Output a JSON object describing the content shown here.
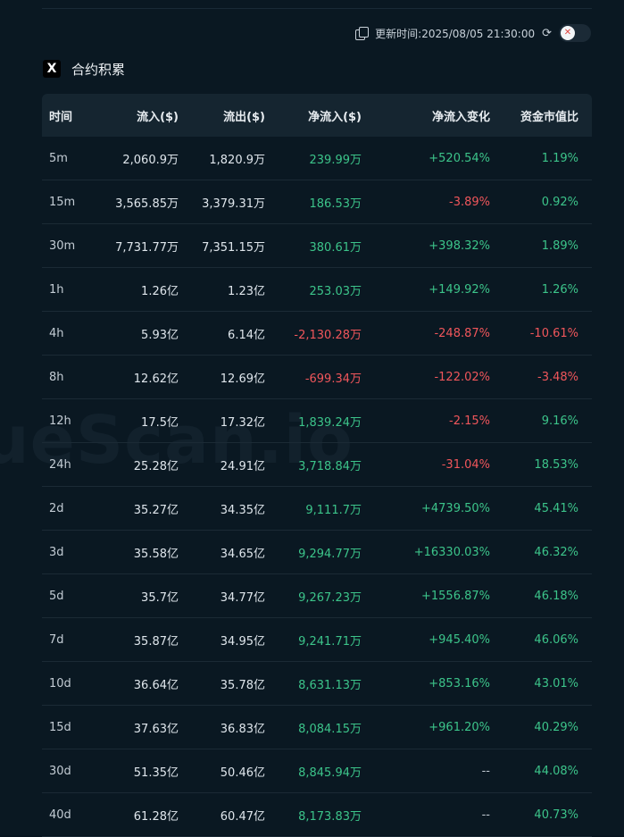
{
  "header": {
    "update_label": "更新时间:2025/08/05 21:30:00",
    "copy_icon": "copy-icon",
    "refresh_icon": "refresh-icon"
  },
  "title": {
    "icon_text": "X",
    "text": "合约积累"
  },
  "watermark": "ueScan.io",
  "table": {
    "columns": [
      "时间",
      "流入($)",
      "流出($)",
      "净流入($)",
      "净流入变化",
      "资金市值比"
    ],
    "rows": [
      [
        "5m",
        "2,060.9万",
        "1,820.9万",
        "239.99万",
        "+520.54%",
        "1.19%"
      ],
      [
        "15m",
        "3,565.85万",
        "3,379.31万",
        "186.53万",
        "-3.89%",
        "0.92%"
      ],
      [
        "30m",
        "7,731.77万",
        "7,351.15万",
        "380.61万",
        "+398.32%",
        "1.89%"
      ],
      [
        "1h",
        "1.26亿",
        "1.23亿",
        "253.03万",
        "+149.92%",
        "1.26%"
      ],
      [
        "4h",
        "5.93亿",
        "6.14亿",
        "-2,130.28万",
        "-248.87%",
        "-10.61%"
      ],
      [
        "8h",
        "12.62亿",
        "12.69亿",
        "-699.34万",
        "-122.02%",
        "-3.48%"
      ],
      [
        "12h",
        "17.5亿",
        "17.32亿",
        "1,839.24万",
        "-2.15%",
        "9.16%"
      ],
      [
        "24h",
        "25.28亿",
        "24.91亿",
        "3,718.84万",
        "-31.04%",
        "18.53%"
      ],
      [
        "2d",
        "35.27亿",
        "34.35亿",
        "9,111.7万",
        "+4739.50%",
        "45.41%"
      ],
      [
        "3d",
        "35.58亿",
        "34.65亿",
        "9,294.77万",
        "+16330.03%",
        "46.32%"
      ],
      [
        "5d",
        "35.7亿",
        "34.77亿",
        "9,267.23万",
        "+1556.87%",
        "46.18%"
      ],
      [
        "7d",
        "35.87亿",
        "34.95亿",
        "9,241.71万",
        "+945.40%",
        "46.06%"
      ],
      [
        "10d",
        "36.64亿",
        "35.78亿",
        "8,631.13万",
        "+853.16%",
        "43.01%"
      ],
      [
        "15d",
        "37.63亿",
        "36.83亿",
        "8,084.15万",
        "+961.20%",
        "40.29%"
      ],
      [
        "30d",
        "51.35亿",
        "50.46亿",
        "8,845.94万",
        "--",
        "44.08%"
      ],
      [
        "40d",
        "61.28亿",
        "60.47亿",
        "8,173.83万",
        "--",
        "40.73%"
      ]
    ]
  },
  "colors": {
    "positive": "#3cc48a",
    "negative": "#f0565b",
    "neutral": "#bfc8d0"
  }
}
